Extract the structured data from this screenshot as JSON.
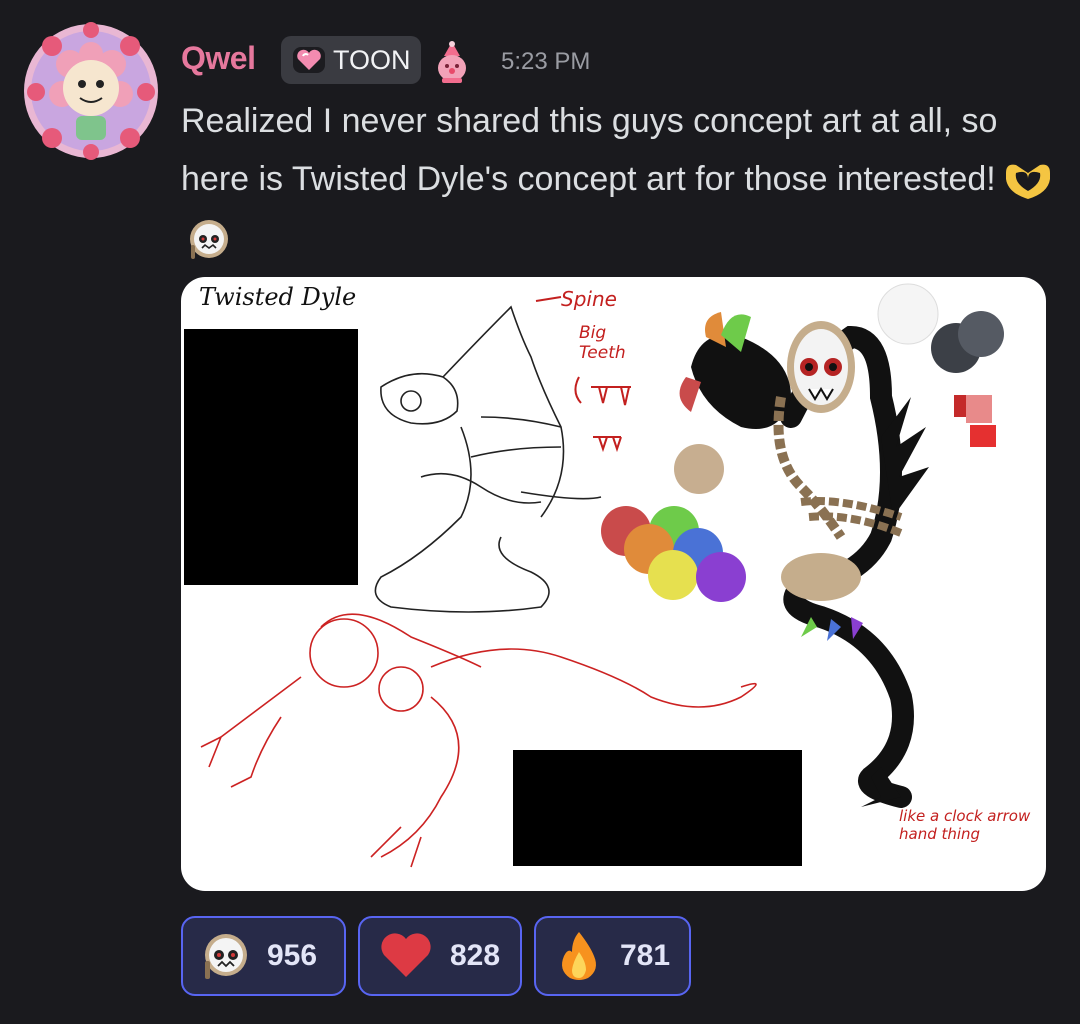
{
  "message": {
    "username": "Qwel",
    "tag_label": "TOON",
    "timestamp": "5:23 PM",
    "text": "Realized I never shared this guys concept art at all, so here is Twisted Dyle's concept art for those interested!",
    "colors": {
      "username": "#e6789d",
      "tag_bg": "#3a3b41",
      "reaction_border": "#5865f2",
      "reaction_bg": "#272a48"
    }
  },
  "attachment": {
    "title": "Twisted Dyle",
    "annotations": {
      "spine": "Spine",
      "big_teeth": "Big Teeth",
      "tail_note": "like a clock arrow hand thing"
    },
    "palette": [
      "#f5f5f5",
      "#3c4047",
      "#555a63",
      "#c42a2a",
      "#e04444",
      "#c7ae90",
      "#c94b4b",
      "#6ecb4a",
      "#e08b3a",
      "#4a72d6",
      "#e6e04f",
      "#8a3fd1"
    ]
  },
  "reactions": [
    {
      "emoji": "clock-mask-emoji",
      "count": "956"
    },
    {
      "emoji": "heart-emoji",
      "count": "828"
    },
    {
      "emoji": "fire-emoji",
      "count": "781"
    }
  ]
}
